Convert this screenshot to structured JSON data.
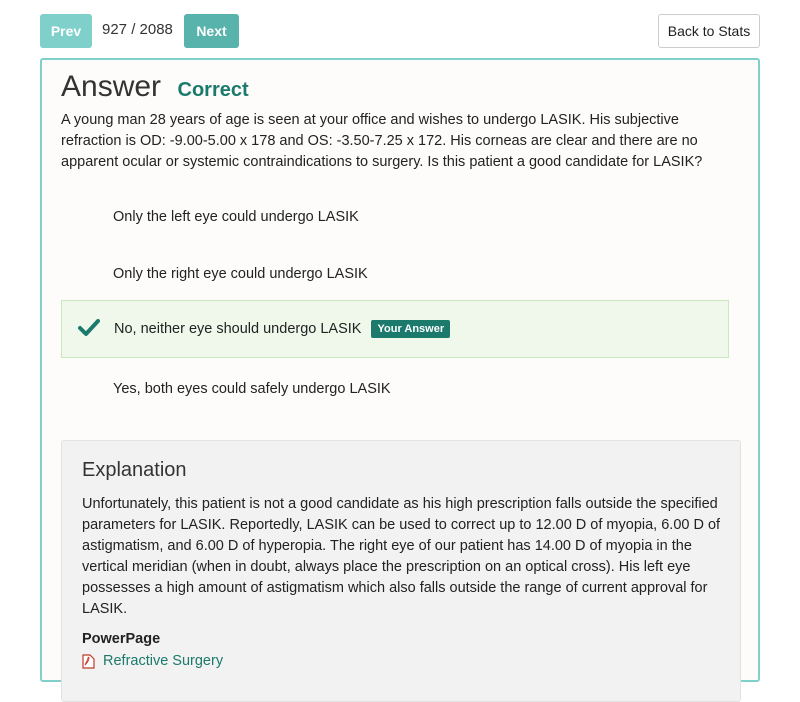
{
  "nav": {
    "prev_label": "Prev",
    "counter": "927 / 2088",
    "next_label": "Next",
    "back_label": "Back to Stats"
  },
  "answer": {
    "title": "Answer",
    "status": "Correct",
    "question": "A young man 28 years of age is seen at your office and wishes to undergo LASIK. His subjective refraction is OD: -9.00-5.00 x 178 and OS: -3.50-7.25 x 172. His corneas are clear and there are no apparent ocular or systemic contraindications to surgery. Is this patient a good candidate for LASIK?",
    "options": [
      {
        "label": "Only the left eye could undergo LASIK"
      },
      {
        "label": "Only the right eye could undergo LASIK"
      },
      {
        "label": "No, neither eye should undergo LASIK",
        "badge": "Your Answer"
      },
      {
        "label": "Yes, both eyes could safely undergo LASIK"
      }
    ]
  },
  "explanation": {
    "title": "Explanation",
    "text": "Unfortunately, this patient is not a good candidate as his high prescription falls outside the specified parameters for LASIK. Reportedly, LASIK can be used to correct up to 12.00 D of myopia, 6.00 D of astigmatism, and 6.00 D of hyperopia. The right eye of our patient has 14.00 D of myopia in the vertical meridian (when in doubt, always place the prescription on an optical cross). His left eye possesses a high amount of astigmatism which also falls outside the range of current approval for LASIK.",
    "powerpage_label": "PowerPage",
    "powerpage_link": "Refractive Surgery"
  },
  "colors": {
    "accent": "#1b7a6c",
    "border": "#7fcfca",
    "prev_button": "#7fcfca",
    "next_button": "#58b3ad",
    "selected_bg": "#f0f8ec"
  },
  "icons": {
    "selected_option": "check-icon",
    "powerpage_link": "pdf-icon"
  }
}
